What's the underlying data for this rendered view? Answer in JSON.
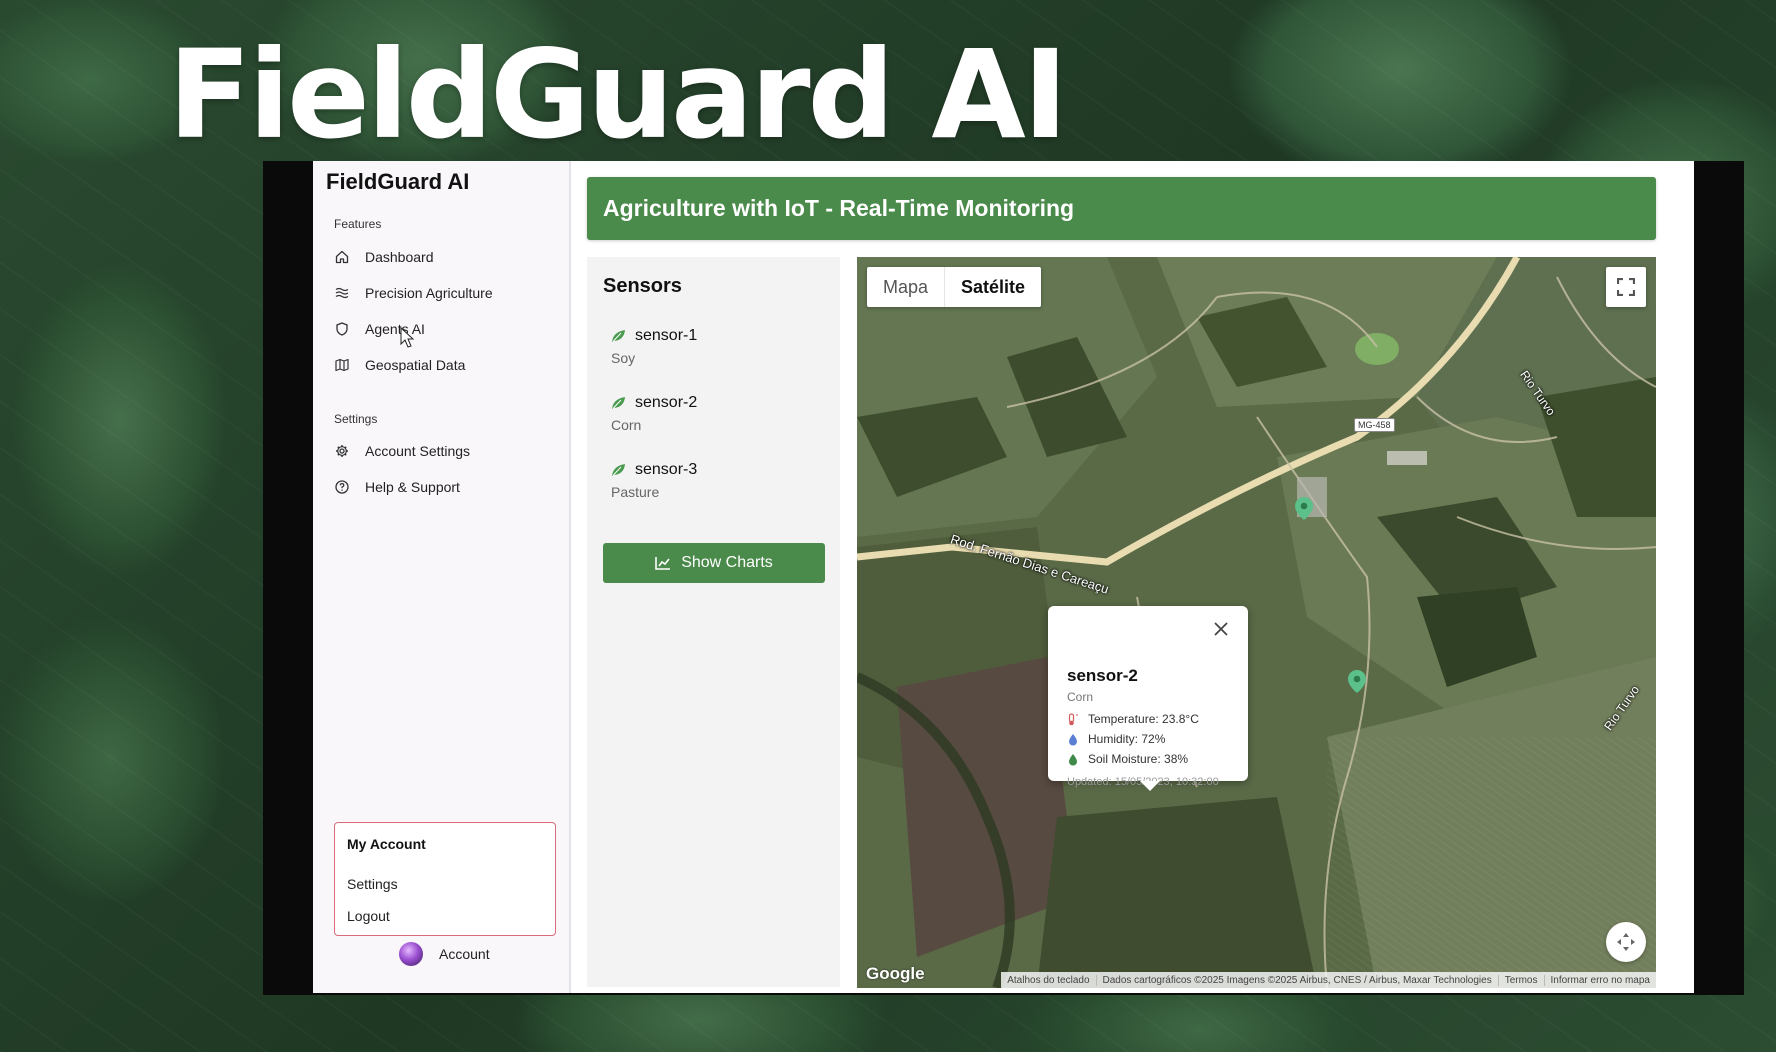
{
  "overlay_title": "FieldGuard AI",
  "app": {
    "brand": "FieldGuard AI",
    "header_title": "Agriculture with IoT - Real-Time Monitoring"
  },
  "sidebar": {
    "features_label": "Features",
    "features": [
      {
        "label": "Dashboard",
        "icon": "home-icon"
      },
      {
        "label": "Precision Agriculture",
        "icon": "waves-icon"
      },
      {
        "label": "Agents AI",
        "icon": "shield-icon"
      },
      {
        "label": "Geospatial Data",
        "icon": "map-icon"
      }
    ],
    "settings_label": "Settings",
    "settings": [
      {
        "label": "Account Settings",
        "icon": "gear-icon"
      },
      {
        "label": "Help & Support",
        "icon": "help-circle-icon"
      }
    ],
    "account_menu": {
      "title": "My Account",
      "items": [
        "Settings",
        "Logout"
      ]
    },
    "account_label": "Account"
  },
  "sensors": {
    "title": "Sensors",
    "items": [
      {
        "name": "sensor-1",
        "crop": "Soy"
      },
      {
        "name": "sensor-2",
        "crop": "Corn"
      },
      {
        "name": "sensor-3",
        "crop": "Pasture"
      }
    ],
    "show_charts_label": "Show Charts"
  },
  "map": {
    "tabs": [
      "Mapa",
      "Satélite"
    ],
    "selected_tab": "Satélite",
    "road_label": "Rod. Fernão Dias e Careaçu",
    "road_shield": "MG-458",
    "river_label_1": "Rio Turvo",
    "river_label_2": "Rio Turvo",
    "google_logo": "Google",
    "attribution": [
      "Atalhos do teclado",
      "Dados cartográficos ©2025 Imagens ©2025 Airbus, CNES / Airbus, Maxar Technologies",
      "Termos",
      "Informar erro no mapa"
    ],
    "popup": {
      "name": "sensor-2",
      "crop": "Corn",
      "temperature": "Temperature: 23.8°C",
      "humidity": "Humidity: 72%",
      "soil_moisture": "Soil Moisture: 38%",
      "updated": "Updated: 15/05/2023, 10:32:00"
    },
    "marker_color": "#5cc08a"
  },
  "colors": {
    "accent_green": "#4a8a4a",
    "account_menu_border": "#d96b7a"
  }
}
